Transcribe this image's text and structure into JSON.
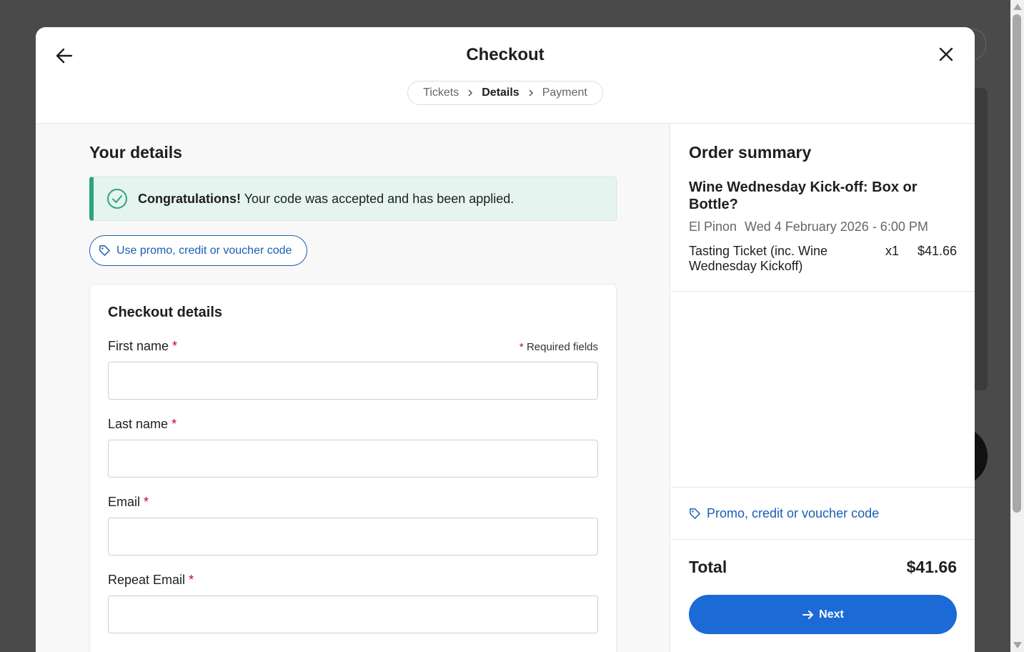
{
  "modal": {
    "title": "Checkout",
    "steps": [
      {
        "label": "Tickets",
        "active": false
      },
      {
        "label": "Details",
        "active": true
      },
      {
        "label": "Payment",
        "active": false
      }
    ]
  },
  "details": {
    "title": "Your details",
    "success_strong": "Congratulations!",
    "success_text": "Your code was accepted and has been applied.",
    "promo_button": "Use promo, credit or voucher code"
  },
  "form": {
    "title": "Checkout details",
    "required_star": "*",
    "required_note": "Required fields",
    "fields": [
      {
        "label": "First name",
        "value": "",
        "placeholder": ""
      },
      {
        "label": "Last name",
        "value": "",
        "placeholder": ""
      },
      {
        "label": "Email",
        "value": "",
        "placeholder": ""
      },
      {
        "label": "Repeat Email",
        "value": "",
        "placeholder": ""
      }
    ]
  },
  "order_summary": {
    "title": "Order summary",
    "event_name": "Wine Wednesday Kick-off: Box or Bottle?",
    "venue": "El Pinon",
    "datetime": "Wed 4 February 2026 - 6:00 PM",
    "line_item": {
      "name": "Tasting Ticket (inc. Wine Wednesday Kickoff)",
      "qty": "x1",
      "price": "$41.66"
    },
    "promo_link": "Promo, credit or voucher code",
    "total_label": "Total",
    "total_value": "$41.66",
    "next_button": "Next"
  },
  "colors": {
    "accent": "#1b6ad6",
    "link": "#1a5fb4",
    "success": "#2aa57a",
    "success_bg": "#e5f4ef",
    "required": "#d0021b"
  }
}
